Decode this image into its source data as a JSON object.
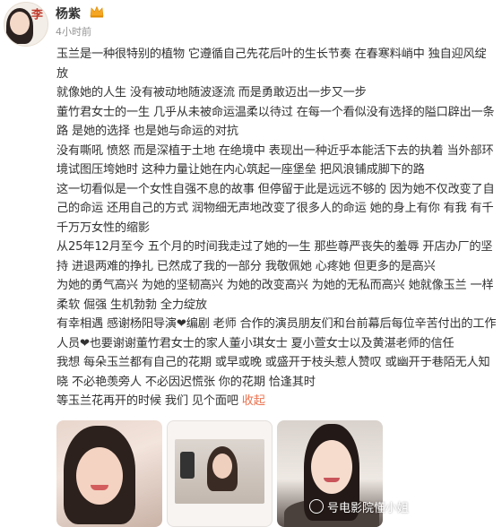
{
  "header": {
    "username": "杨紫",
    "timestamp": "4小时前",
    "avatar_text": "李",
    "crown_icon": "crown-icon"
  },
  "post": {
    "lines": [
      "玉兰是一种很特别的植物 它遵循自己先花后叶的生长节奏 在春寒料峭中 独自迎风绽放",
      "就像她的人生 没有被动地随波逐流 而是勇敢迈出一步又一步",
      "董竹君女士的一生 几乎从未被命运温柔以待过 在每一个看似没有选择的隘口辟出一条路 是她的选择 也是她与命运的对抗",
      "没有嘶吼 愤怒 而是深植于土地 在绝境中 表现出一种近乎本能活下去的执着 当外部环境试图压垮她时 这种力量让她在内心筑起一座堡垒 把风浪铺成脚下的路",
      "这一切看似是一个女性自强不息的故事 但停留于此是远远不够的 因为她不仅改变了自己的命运 还用自己的方式 润物细无声地改变了很多人的命运 她的身上有你 有我 有千千万万女性的缩影",
      "从25年12月至今 五个月的时间我走过了她的一生 那些尊严丧失的羞辱 开店办厂的坚持 进退两难的挣扎 已然成了我的一部分 我敬佩她 心疼她 但更多的是高兴",
      "为她的勇气高兴 为她的坚韧高兴 为她的改变高兴 为她的无私而高兴 她就像玉兰 一样柔软 倔强 生机勃勃 全力绽放",
      "有幸相遇 感谢杨阳导演❤编剧 老师 合作的演员朋友们和台前幕后每位辛苦付出的工作人员❤也要谢谢董竹君女士的家人董小琪女士 夏小萱女士以及黄湛老师的信任",
      "我想 每朵玉兰都有自己的花期 或早或晚 或盛开于枝头惹人赞叹 或幽开于巷陌无人知晓 不必艳羡旁人 不必因迟慌张 你的花期 恰逢其时"
    ],
    "last_line": "等玉兰花再开的时候 我们 见个面吧",
    "collapse_label": "收起"
  },
  "images": [
    {
      "name": "photo-1",
      "desc_icon": "portrait-image"
    },
    {
      "name": "photo-2",
      "desc_icon": "framed-photo-image"
    },
    {
      "name": "photo-3",
      "desc_icon": "portrait-image"
    }
  ],
  "watermark": {
    "text": "号电影院懂小姐"
  },
  "colors": {
    "link": "#eb7350",
    "time": "#939393",
    "text": "#333333"
  }
}
